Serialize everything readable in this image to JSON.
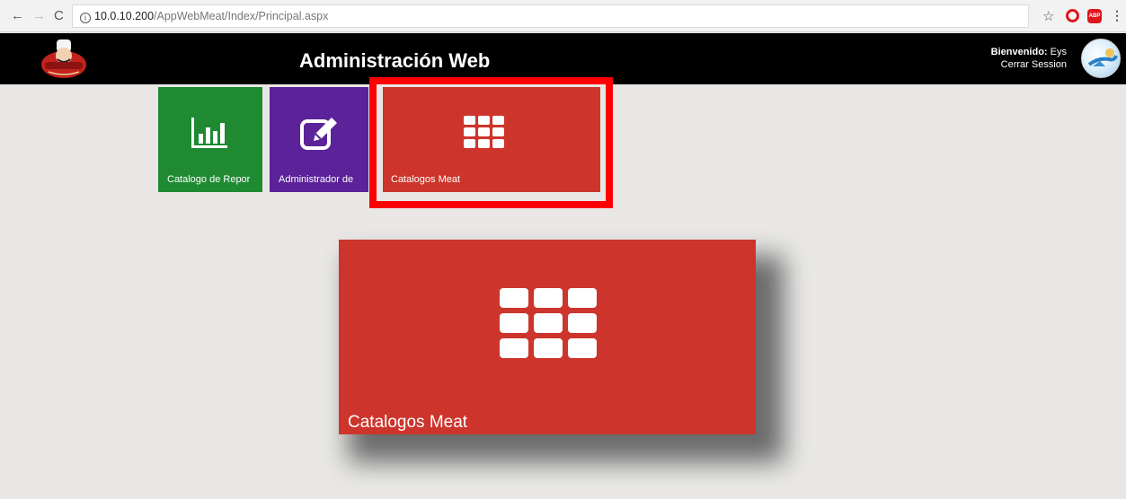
{
  "browser": {
    "back": "←",
    "forward": "→",
    "reload": "C",
    "url_host": "10.0.10.200",
    "url_path": "/AppWebMeat/Index/Principal.aspx",
    "info_glyph": "i",
    "star": "☆",
    "abp": "ABP",
    "menu": "⋮"
  },
  "header": {
    "title": "Administración Web",
    "welcome_label": "Bienvenido:",
    "user_name": "Eys",
    "logout_label": "Cerrar Session"
  },
  "tiles": [
    {
      "label": "Catalogo de Repor",
      "icon": "bar-chart-icon",
      "color": "#1f8a32"
    },
    {
      "label": "Administrador de",
      "icon": "edit-icon",
      "color": "#5b2299"
    },
    {
      "label": "Catalogos Meat",
      "icon": "grid-icon",
      "color": "#cd352c"
    }
  ],
  "zoom_tile": {
    "label": "Catalogos Meat",
    "icon": "grid-icon",
    "color": "#cd352c"
  },
  "highlight_color": "#ff0000",
  "header_color": "#000000",
  "background_color": "#e8e7e5"
}
